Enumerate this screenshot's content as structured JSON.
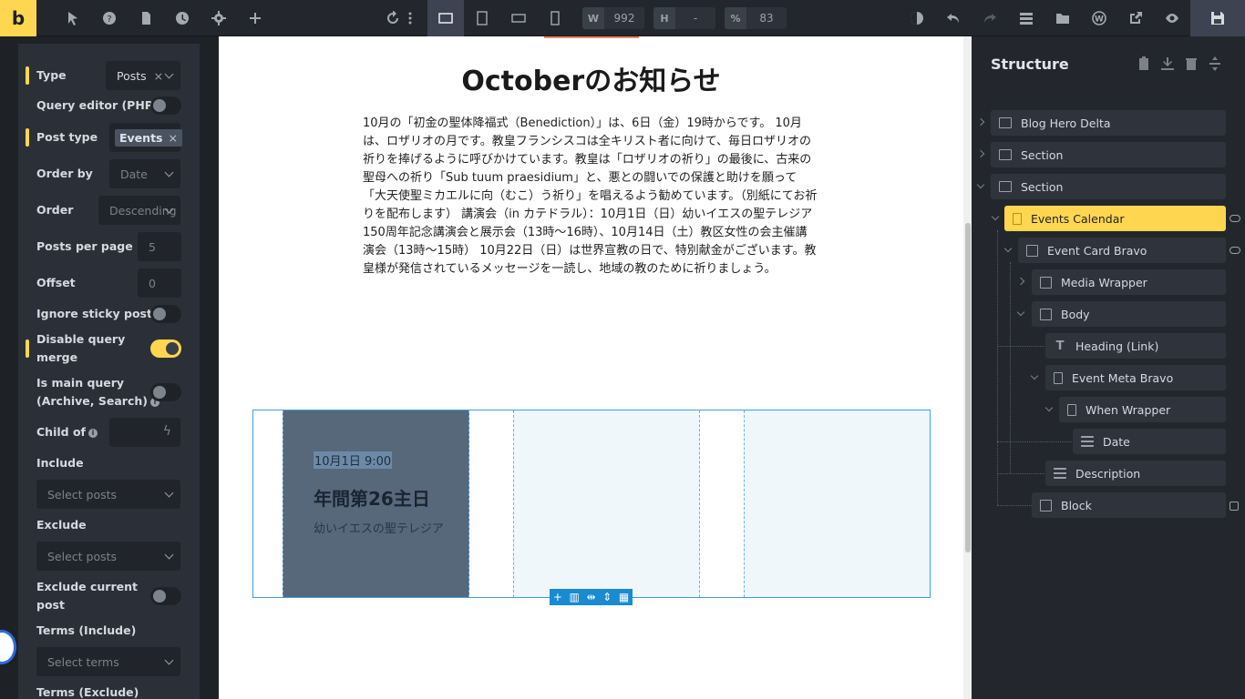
{
  "topbar": {
    "logo": "b",
    "width_tag": "W",
    "width_value": "992",
    "height_tag": "H",
    "height_value": "-",
    "zoom_tag": "%",
    "zoom_value": "83"
  },
  "query_panel": {
    "type_label": "Type",
    "type_value": "Posts",
    "query_editor_label": "Query editor (PHP)",
    "post_type_label": "Post type",
    "post_type_value": "Events",
    "order_by_label": "Order by",
    "order_by_value": "Date",
    "order_label": "Order",
    "order_value": "Descending",
    "posts_per_page_label": "Posts per page",
    "posts_per_page_value": "5",
    "offset_label": "Offset",
    "offset_value": "0",
    "ignore_sticky_label": "Ignore sticky posts",
    "disable_merge_label_1": "Disable query",
    "disable_merge_label_2": "merge",
    "main_query_label_1": "Is main query",
    "main_query_label_2": "(Archive, Search)",
    "child_of_label": "Child of",
    "include_label": "Include",
    "include_placeholder": "Select posts",
    "exclude_label": "Exclude",
    "exclude_placeholder": "Select posts",
    "exclude_current_label_1": "Exclude current",
    "exclude_current_label_2": "post",
    "terms_include_label": "Terms (Include)",
    "terms_include_placeholder": "Select terms",
    "terms_exclude_label": "Terms (Exclude)"
  },
  "canvas": {
    "heading": "Octoberのお知らせ",
    "body": "10月の「初金の聖体降福式（Benediction）」は、6日（金）19時からです。 10月は、ロザリオの月です。教皇フランシスコは全キリスト者に向けて、毎日ロザリオの祈りを捧げるように呼びかけています。教皇は「ロザリオの祈り」の最後に、古来の聖母への祈り「Sub tuum praesidium」と、悪との闘いでの保護と助けを願って「大天使聖ミカエルに向（むこ）う祈り」を唱えるよう勧めています。（別紙にてお祈りを配布します） 講演会（in カテドラル）：10月1日（日）幼いイエスの聖テレジア150周年記念講演会と展示会（13時～16時）、10月14日（土）教区女性の会主催講演会（13時～15時） 10月22日（日）は世界宣教の日で、特別献金がございます。教皇様が発信されているメッセージを一読し、地域の教のために祈りましょう。",
    "card_date": "10月1日 9:00",
    "card_title": "年間第26主日",
    "card_desc": "幼いイエスの聖テレジア"
  },
  "structure": {
    "title": "Structure",
    "items": [
      {
        "label": "Blog Hero Delta"
      },
      {
        "label": "Section"
      },
      {
        "label": "Section"
      },
      {
        "label": "Events Calendar"
      },
      {
        "label": "Event Card Bravo"
      },
      {
        "label": "Media Wrapper"
      },
      {
        "label": "Body"
      },
      {
        "label": "Heading (Link)"
      },
      {
        "label": "Event Meta Bravo"
      },
      {
        "label": "When Wrapper"
      },
      {
        "label": "Date"
      },
      {
        "label": "Description"
      },
      {
        "label": "Block"
      }
    ]
  },
  "colors": {
    "accent": "#ffd64f",
    "selection": "#3aa0e0",
    "panel": "#2b3038"
  }
}
